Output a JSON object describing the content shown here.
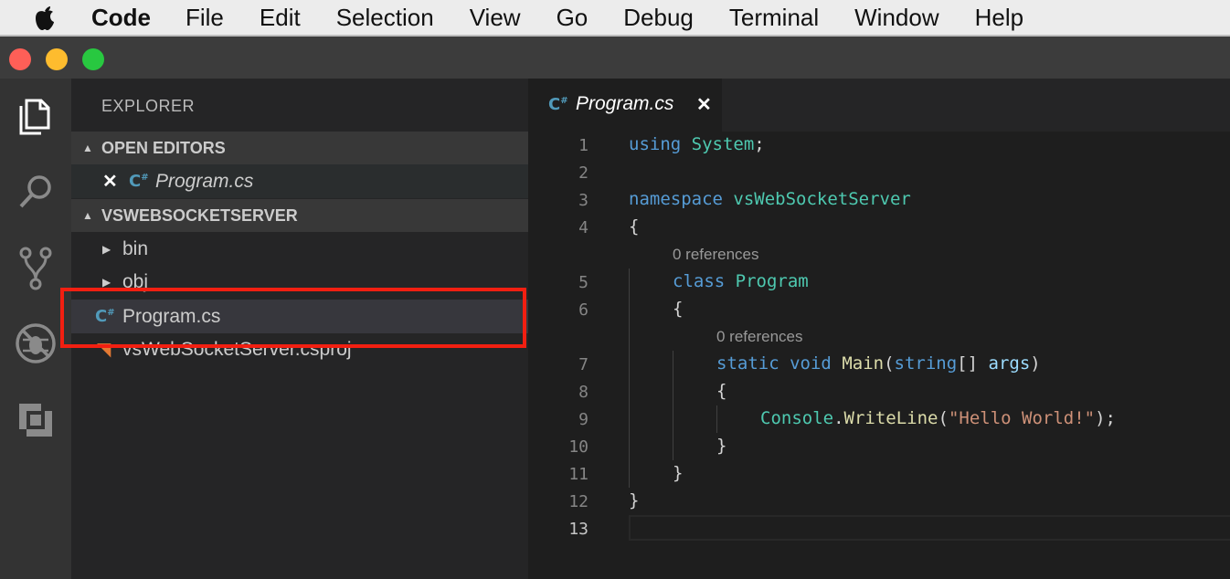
{
  "menubar": {
    "apple_icon": "apple-logo",
    "items": [
      "Code",
      "File",
      "Edit",
      "Selection",
      "View",
      "Go",
      "Debug",
      "Terminal",
      "Window",
      "Help"
    ]
  },
  "window": {
    "traffic_lights": [
      "close",
      "minimize",
      "zoom"
    ],
    "colors": {
      "close": "#fe5f57",
      "minimize": "#febc2e",
      "zoom": "#28c840"
    }
  },
  "activity_bar": {
    "icons": [
      "files-icon",
      "search-icon",
      "source-control-icon",
      "debug-icon",
      "extensions-icon"
    ]
  },
  "sidebar": {
    "title": "EXPLORER",
    "open_editors": {
      "header": "OPEN EDITORS",
      "items": [
        {
          "name": "Program.cs",
          "close": "✕",
          "icon": "csharp-icon"
        }
      ]
    },
    "project": {
      "header": "VSWEBSOCKETSERVER",
      "items": [
        {
          "name": "bin",
          "type": "folder"
        },
        {
          "name": "obj",
          "type": "folder"
        },
        {
          "name": "Program.cs",
          "type": "file",
          "icon": "csharp-icon",
          "selected": true
        },
        {
          "name": "vsWebSocketServer.csproj",
          "type": "file",
          "icon": "rss-icon"
        }
      ]
    }
  },
  "editor": {
    "tab": {
      "label": "Program.cs",
      "close": "✕",
      "icon": "csharp-icon"
    },
    "line_numbers": [
      "1",
      "2",
      "3",
      "4",
      "5",
      "6",
      "7",
      "8",
      "9",
      "10",
      "11",
      "12",
      "13"
    ],
    "code_lens": [
      "0 references",
      "0 references"
    ],
    "lines": {
      "l1": {
        "kw": "using",
        "ty": "System",
        "rest": ";"
      },
      "l3": {
        "kw": "namespace",
        "ty": "vsWebSocketServer"
      },
      "l4": "{",
      "l5": {
        "kw": "class",
        "ty": "Program"
      },
      "l6": "{",
      "l7": {
        "kw1": "static",
        "kw2": "void",
        "fn": "Main",
        "open": "(",
        "kw3": "string",
        "mid": "[] ",
        "pr": "args",
        "close": ")"
      },
      "l8": "{",
      "l9": {
        "ty": "Console",
        "dot": ".",
        "fn": "WriteLine",
        "open": "(",
        "st": "\"Hello World!\"",
        "close": ");"
      },
      "l10": "}",
      "l11": "}",
      "l12": "}"
    }
  },
  "highlight_color": "#f21f11"
}
